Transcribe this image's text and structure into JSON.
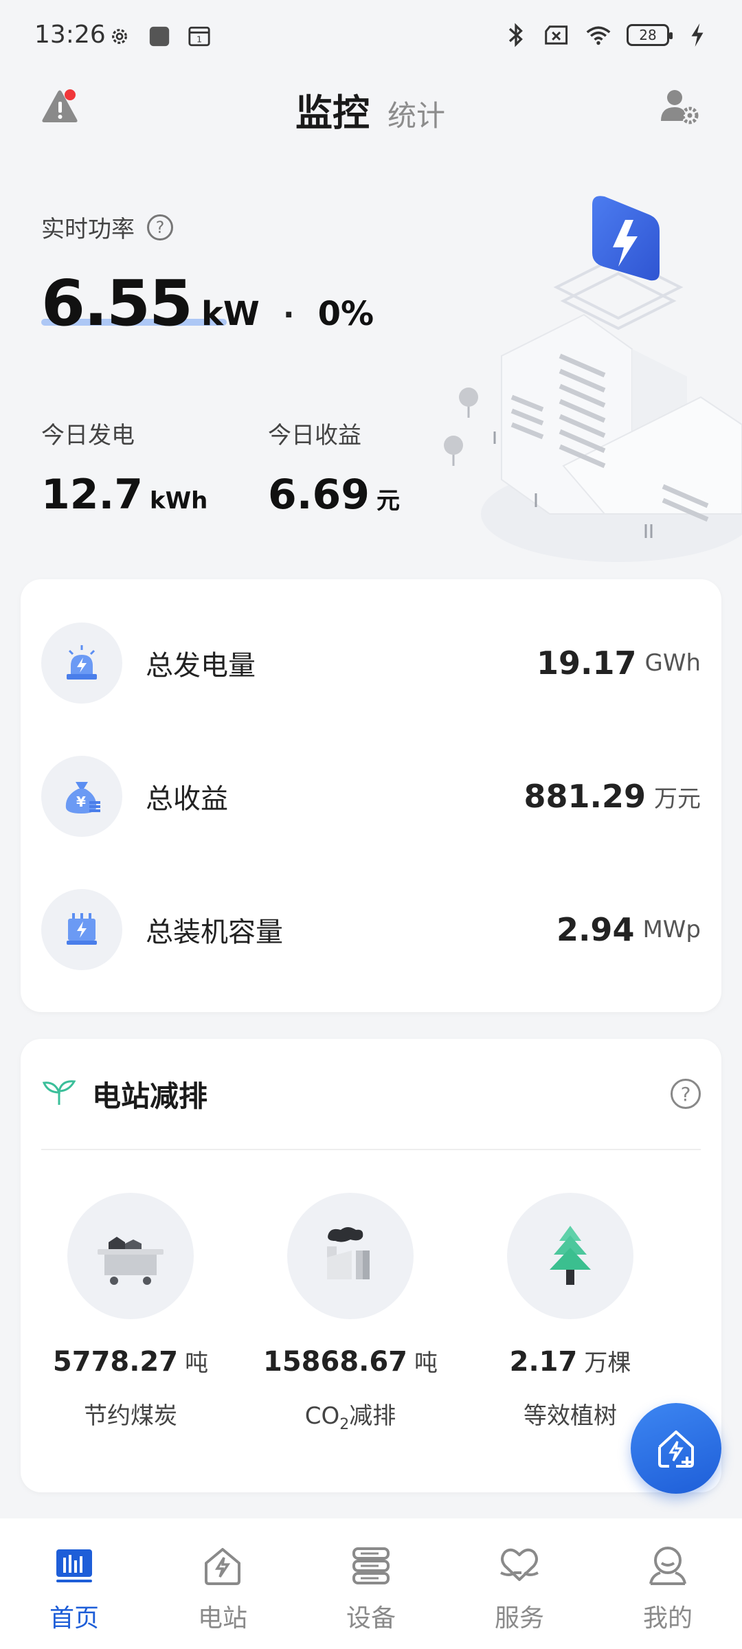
{
  "status_bar": {
    "time": "13:26",
    "battery": "28",
    "icons_left": [
      "gear-icon",
      "app-square-icon",
      "calendar-icon"
    ],
    "icons_right": [
      "bluetooth-icon",
      "sim-x-icon",
      "wifi-icon",
      "battery-icon",
      "charging-bolt-icon"
    ]
  },
  "topnav": {
    "tab_active": "监控",
    "tab_inactive": "统计"
  },
  "hero": {
    "power_label": "实时功率",
    "power_help": "?",
    "power_value": "6.55",
    "power_unit": "kW",
    "separator": "·",
    "power_percent": "0%",
    "today_generation_label": "今日发电",
    "today_generation_value": "12.7",
    "today_generation_unit": "kWh",
    "today_income_label": "今日收益",
    "today_income_value": "6.69",
    "today_income_unit": "元"
  },
  "totals": [
    {
      "label": "总发电量",
      "value": "19.17",
      "unit": "GWh",
      "icon": "alarm-bolt-icon"
    },
    {
      "label": "总收益",
      "value": "881.29",
      "unit": "万元",
      "icon": "money-bag-icon"
    },
    {
      "label": "总装机容量",
      "value": "2.94",
      "unit": "MWp",
      "icon": "capacity-box-icon"
    }
  ],
  "emission": {
    "title": "电站减排",
    "help": "?",
    "items": [
      {
        "value": "5778.27",
        "unit": "吨",
        "label": "节约煤炭",
        "icon": "coal-cart-icon"
      },
      {
        "value": "15868.67",
        "unit": "吨",
        "label_prefix": "CO",
        "label_sub": "2",
        "label_suffix": "减排",
        "icon": "factory-smoke-icon"
      },
      {
        "value": "2.17",
        "unit": "万棵",
        "label": "等效植树",
        "icon": "tree-icon"
      }
    ]
  },
  "bottom_nav": [
    {
      "label": "首页",
      "icon": "home-chart-icon",
      "active": true
    },
    {
      "label": "电站",
      "icon": "station-icon",
      "active": false
    },
    {
      "label": "设备",
      "icon": "device-icon",
      "active": false
    },
    {
      "label": "服务",
      "icon": "service-heart-icon",
      "active": false
    },
    {
      "label": "我的",
      "icon": "profile-icon",
      "active": false
    }
  ],
  "colors": {
    "accent": "#1e5ed8",
    "background": "#f4f5f7",
    "icon_circle": "#eff1f5"
  }
}
